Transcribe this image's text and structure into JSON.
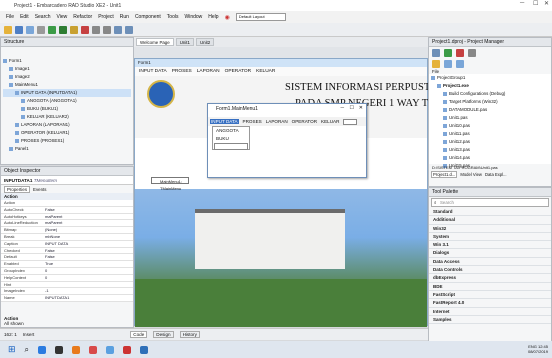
{
  "window": {
    "title": "Project1 - Embarcadero RAD Studio XE2 - Unit1"
  },
  "menu": {
    "items": [
      "File",
      "Edit",
      "Search",
      "View",
      "Refactor",
      "Project",
      "Run",
      "Component",
      "Tools",
      "Window",
      "Help"
    ],
    "layout_value": "Default Layout"
  },
  "structure": {
    "title": "Structure",
    "items": [
      {
        "label": "Form1",
        "indent": 0
      },
      {
        "label": "Image1",
        "indent": 1
      },
      {
        "label": "Image2",
        "indent": 1
      },
      {
        "label": "MainMenu1",
        "indent": 1
      },
      {
        "label": "INPUT DATA (INPUTDATA1)",
        "indent": 2,
        "selected": true
      },
      {
        "label": "ANGGOTA (ANGGOTA1)",
        "indent": 3
      },
      {
        "label": "BUKU (BUKU1)",
        "indent": 3
      },
      {
        "label": "KELUAR (KELUAR2)",
        "indent": 3
      },
      {
        "label": "LAPORAN (LAPORAN1)",
        "indent": 2
      },
      {
        "label": "OPERATOR (KELUAR1)",
        "indent": 2
      },
      {
        "label": "PROSES (PROSES1)",
        "indent": 2
      },
      {
        "label": "Panel1",
        "indent": 1
      }
    ]
  },
  "inspector": {
    "title": "Object Inspector",
    "object": "INPUTDATA1",
    "object_type": "TMenuItem",
    "tabs": [
      "Properties",
      "Events"
    ],
    "section": "Action",
    "footer_section": "Action",
    "footer_text": "All shown",
    "props": [
      [
        "Action",
        ""
      ],
      [
        "AutoCheck",
        "False"
      ],
      [
        "AutoHotkeys",
        "maParent"
      ],
      [
        "AutoLineReduction",
        "maParent"
      ],
      [
        "Bitmap",
        "(None)"
      ],
      [
        "Break",
        "mbNone"
      ],
      [
        "Caption",
        "INPUT DATA"
      ],
      [
        "Checked",
        "False"
      ],
      [
        "Default",
        "False"
      ],
      [
        "Enabled",
        "True"
      ],
      [
        "GroupIndex",
        "0"
      ],
      [
        "HelpContext",
        "0"
      ],
      [
        "Hint",
        ""
      ],
      [
        "ImageIndex",
        "-1"
      ],
      [
        "Name",
        "INPUTDATA1"
      ]
    ]
  },
  "tabs": [
    "Welcome Page",
    "Unit1",
    "Unit2"
  ],
  "form": {
    "title": "Form1",
    "menu": [
      "INPUT DATA",
      "PROSES",
      "LAPORAN",
      "OPERATOR",
      "KELUAR"
    ],
    "heading1": "SISTEM INFORMASI PERPUSTAK",
    "heading2": "PADA SMP NEGERI 1 WAY TUA"
  },
  "submenu": {
    "title": "Form1.MainMenu1",
    "menu": [
      "INPUT DATA",
      "PROSES",
      "LAPORAN",
      "OPERATOR",
      "KELUAR"
    ],
    "items": [
      "ANGGOTA",
      "BUKU"
    ]
  },
  "component": {
    "label": "MainMenu1: TMainMenu"
  },
  "project": {
    "title": "Project1.dproj - Project Manager",
    "file": "File",
    "items": [
      {
        "label": "ProjectGroup1",
        "indent": 0
      },
      {
        "label": "Project1.exe",
        "indent": 1,
        "bold": true
      },
      {
        "label": "Build Configurations (Debug)",
        "indent": 2
      },
      {
        "label": "Target Platforms (Win32)",
        "indent": 2
      },
      {
        "label": "DATAMODULE.pas",
        "indent": 2
      },
      {
        "label": "Unit1.pas",
        "indent": 2
      },
      {
        "label": "Unit10.pas",
        "indent": 2
      },
      {
        "label": "Unit11.pas",
        "indent": 2
      },
      {
        "label": "Unit12.pas",
        "indent": 2
      },
      {
        "label": "Unit13.pas",
        "indent": 2
      },
      {
        "label": "Unit14.pas",
        "indent": 2
      },
      {
        "label": "Unit15.pas",
        "indent": 2
      }
    ],
    "path": "D:\\SISTEM TA\\PROGRAM\\Unit1.pas",
    "tabs": [
      "Project1.d...",
      "Model View",
      "Data Expl..."
    ]
  },
  "palette": {
    "title": "Tool Palette",
    "search": "Search",
    "items": [
      "Standard",
      "Additional",
      "Win32",
      "System",
      "Win 3.1",
      "Dialogs",
      "Data Access",
      "Data Controls",
      "dbExpress",
      "BDE",
      "FastScript",
      "FastReport 4.0",
      "Internet",
      "Samples"
    ]
  },
  "status": {
    "position": "162: 1",
    "mode": "Insert",
    "tabs": [
      "Code",
      "Design",
      "History"
    ]
  },
  "taskbar": {
    "time": "12:45",
    "date": "08/07/2019",
    "lang": "ENG"
  }
}
